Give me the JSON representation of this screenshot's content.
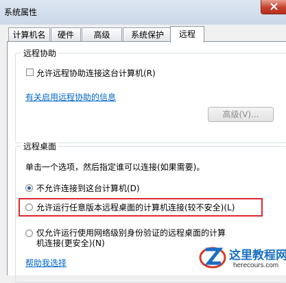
{
  "window": {
    "title": "系统属性"
  },
  "tabs": [
    {
      "label": "计算机名"
    },
    {
      "label": "硬件"
    },
    {
      "label": "高级"
    },
    {
      "label": "系统保护"
    },
    {
      "label": "远程"
    }
  ],
  "remote_assistance": {
    "group_title": "远程协助",
    "checkbox_label": "允许远程协助连接这台计算机(R)",
    "checkbox_checked": false,
    "info_link": "有关启用远程协助的信息",
    "advanced_button": "高级(V)..."
  },
  "remote_desktop": {
    "group_title": "远程桌面",
    "instruction": "单击一个选项，然后指定谁可以连接(如果需要)。",
    "options": [
      {
        "label": "不允许连接到这台计算机(D)",
        "checked": true
      },
      {
        "label": "允许运行任意版本远程桌面的计算机连接(较不安全)(L)",
        "checked": false
      },
      {
        "label_line1": "仅允许运行使用网络级别身份验证的远程桌面的计算",
        "label_line2": "机连接(更安全)(N)",
        "checked": false
      }
    ],
    "help_link": "帮助我选择"
  },
  "watermark": {
    "title": "这里教程网",
    "url": "herecours.com"
  },
  "colors": {
    "link": "#0066cc",
    "highlight": "#e0252c",
    "radio_selected": "#2a5cad"
  }
}
